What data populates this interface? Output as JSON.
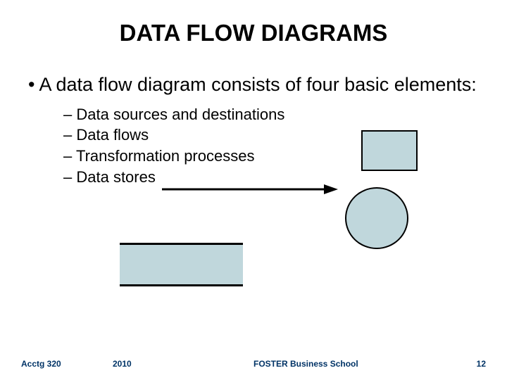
{
  "title": "DATA FLOW DIAGRAMS",
  "main_bullet": "A data flow diagram consists of four basic elements:",
  "sub_items": [
    "Data sources and destinations",
    "Data flows",
    "Transformation processes",
    "Data stores"
  ],
  "footer": {
    "course": "Acctg 320",
    "year": "2010",
    "school": "FOSTER Business School",
    "page": "12"
  },
  "colors": {
    "shape_fill": "#c0d7dc",
    "footer_text": "#003366"
  }
}
